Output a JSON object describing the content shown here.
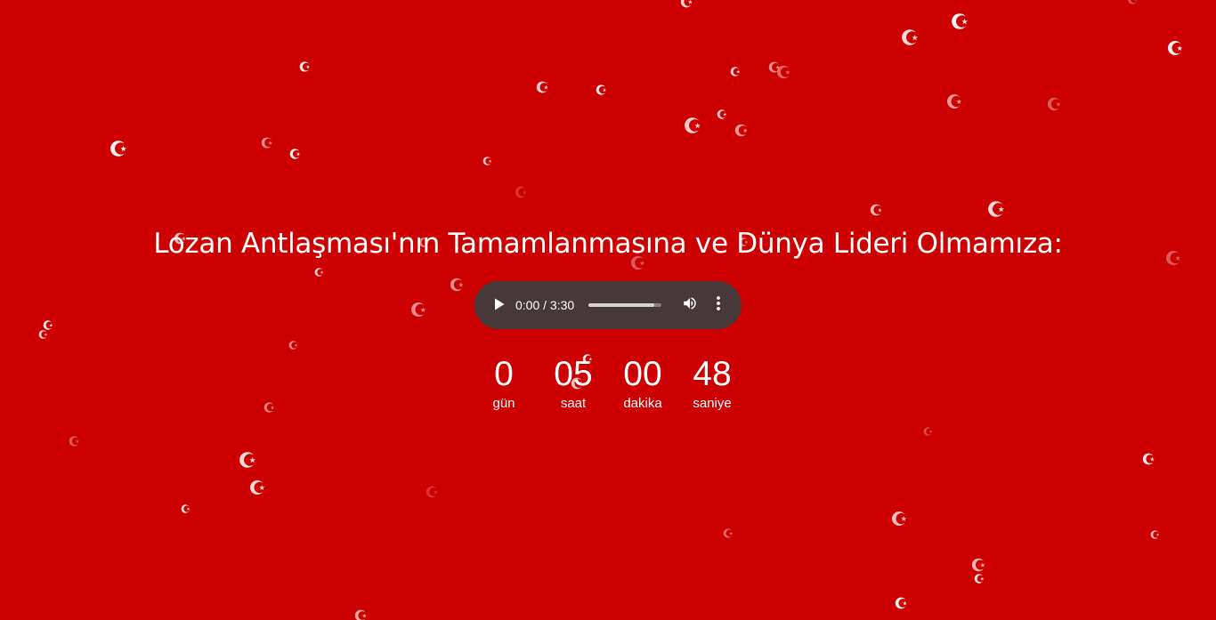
{
  "page": {
    "background_color": "#cc0000",
    "headline": "Lozan Antlaşması'nın Tamamlanmasına ve Dünya Lideri Olmamıza:"
  },
  "audio_player": {
    "time_display": "0:00 / 3:30",
    "current_time": "0:00",
    "duration": "3:30",
    "icons": [
      "play-icon",
      "volume-icon",
      "more-vertical-icon"
    ]
  },
  "countdown": {
    "units": [
      {
        "value": "0",
        "label": "gün"
      },
      {
        "value": "05",
        "label": "saat"
      },
      {
        "value": "00",
        "label": "dakika"
      },
      {
        "value": "48",
        "label": "saniye"
      }
    ]
  },
  "decoration": {
    "symbol_icon": "crescent-star-icon",
    "symbol_color": "#ffffff"
  }
}
